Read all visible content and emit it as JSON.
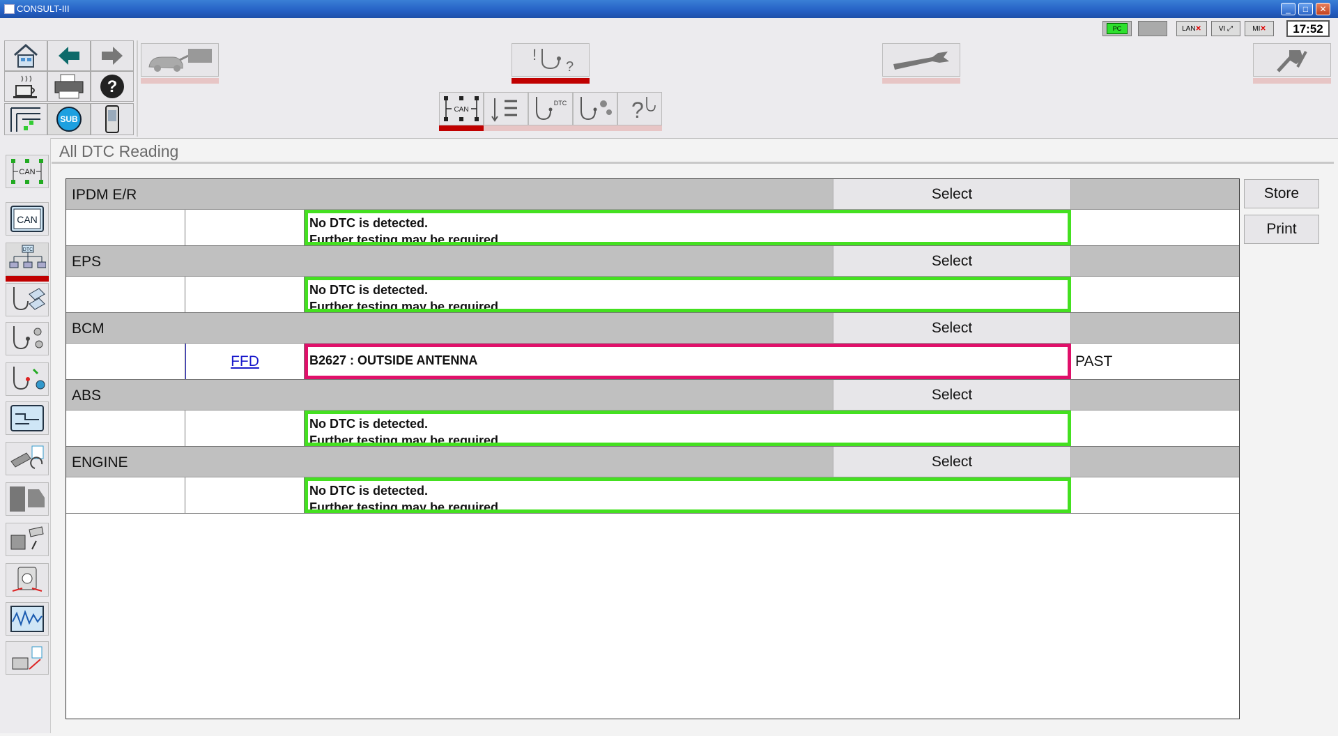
{
  "window": {
    "title": "CONSULT-III"
  },
  "status": {
    "pc_label": "PC",
    "lan_label": "LAN",
    "vi_label": "VI",
    "mi_label": "MI",
    "clock": "17:52"
  },
  "toolbar": {
    "sub_label": "SUB",
    "can_label": "CAN",
    "dtc_label": "DTC"
  },
  "sidebar": {
    "can_label1": "CAN",
    "can_label2": "CAN",
    "dtc_label": "DTC"
  },
  "page": {
    "title": "All DTC Reading"
  },
  "systems": [
    {
      "name": "IPDM E/R",
      "select": "Select",
      "ffd": "",
      "message_line1": "No DTC is detected.",
      "message_line2": "Further testing may be required.",
      "status": ""
    },
    {
      "name": "EPS",
      "select": "Select",
      "ffd": "",
      "message_line1": "No DTC is detected.",
      "message_line2": "Further testing may be required.",
      "status": ""
    },
    {
      "name": "BCM",
      "select": "Select",
      "ffd": "FFD",
      "message_line1": "B2627 : OUTSIDE ANTENNA",
      "message_line2": "",
      "status": "PAST"
    },
    {
      "name": "ABS",
      "select": "Select",
      "ffd": "",
      "message_line1": "No DTC is detected.",
      "message_line2": "Further testing may be required.",
      "status": ""
    },
    {
      "name": "ENGINE",
      "select": "Select",
      "ffd": "",
      "message_line1": "No DTC is detected.",
      "message_line2": "Further testing may be required.",
      "status": ""
    }
  ],
  "actions": {
    "store": "Store",
    "print": "Print"
  },
  "colors": {
    "ok_border": "#44e020",
    "fault_border": "#e0106a",
    "active_tab": "#c00000",
    "link": "#1a1acc"
  }
}
